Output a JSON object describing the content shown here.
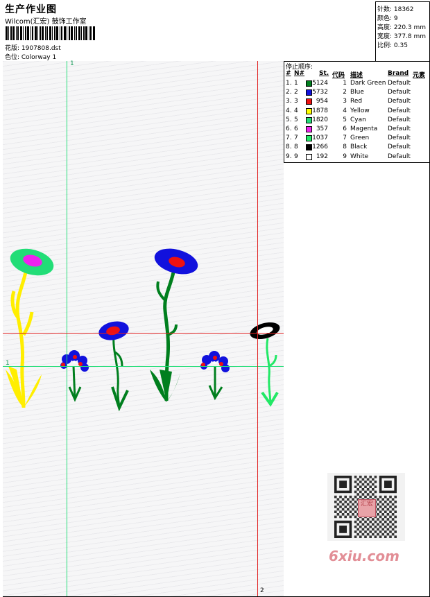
{
  "header": {
    "title": "生产作业图",
    "subtitle": "Wilcom(汇宏) 鼓饰工作室",
    "design_label": "花版: 1907808.dst",
    "colorway_label": "色位: Colorway 1"
  },
  "stats": {
    "stitches": "针数: 18362",
    "colors": "颜色: 9",
    "height": "高度: 220.3 mm",
    "width": "宽度: 377.8 mm",
    "scale": "比例: 0.35"
  },
  "guides": {
    "v1_label": "1",
    "h1_label": "1",
    "v2_label": "2"
  },
  "stop_sequence": {
    "title": "停止顺序:",
    "headers": {
      "num": "#",
      "no": "N#",
      "stitches": "St.",
      "code": "代码",
      "description": "描述",
      "brand": "Brand",
      "element": "元素"
    },
    "rows": [
      {
        "num": "1.",
        "no": "1",
        "st": "5124",
        "code": "1",
        "desc": "Dark Green",
        "brand": "Default",
        "color": "#007f1e"
      },
      {
        "num": "2.",
        "no": "2",
        "st": "5732",
        "code": "2",
        "desc": "Blue",
        "brand": "Default",
        "color": "#1111dd"
      },
      {
        "num": "3.",
        "no": "3",
        "st": "954",
        "code": "3",
        "desc": "Red",
        "brand": "Default",
        "color": "#ee1111"
      },
      {
        "num": "4.",
        "no": "4",
        "st": "1878",
        "code": "4",
        "desc": "Yellow",
        "brand": "Default",
        "color": "#ffff00"
      },
      {
        "num": "5.",
        "no": "5",
        "st": "1820",
        "code": "5",
        "desc": "Cyan",
        "brand": "Default",
        "color": "#22dd77"
      },
      {
        "num": "6.",
        "no": "6",
        "st": "357",
        "code": "6",
        "desc": "Magenta",
        "brand": "Default",
        "color": "#ee22ee"
      },
      {
        "num": "7.",
        "no": "7",
        "st": "1037",
        "code": "7",
        "desc": "Green",
        "brand": "Default",
        "color": "#22e866"
      },
      {
        "num": "8.",
        "no": "8",
        "st": "1266",
        "code": "8",
        "desc": "Black",
        "brand": "Default",
        "color": "#000000"
      },
      {
        "num": "9.",
        "no": "9",
        "st": "192",
        "code": "9",
        "desc": "White",
        "brand": "Default",
        "color": "#ffffff"
      }
    ]
  },
  "watermark": {
    "qr_stamp": "汇宏",
    "site": "6xiu.com"
  }
}
